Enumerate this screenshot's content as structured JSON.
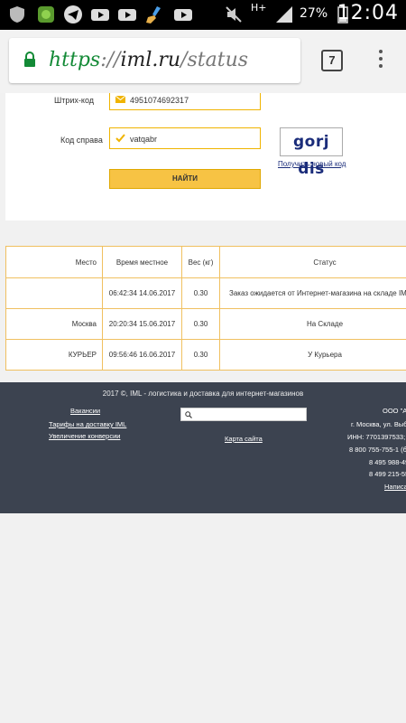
{
  "statusbar": {
    "network": "H+",
    "battery": "27%",
    "time": "12:04",
    "icons": [
      "shield-icon",
      "app-icon",
      "telegram-icon",
      "youtube-icon",
      "youtube-icon",
      "broom-icon",
      "youtube-icon",
      "mute-icon",
      "signal-icon",
      "battery-icon"
    ]
  },
  "browser": {
    "url_scheme": "https",
    "url_separator": "://",
    "url_host": "iml.ru",
    "url_path": "/status",
    "tab_count": "7"
  },
  "form": {
    "barcode_label": "Штрих-код",
    "barcode_value": "4951074692317",
    "captcha_label": "Код справа",
    "captcha_value": "vatqabr",
    "captcha_image_text": "gorj dis",
    "new_code_link": "Получить новый код",
    "submit_label": "НАЙТИ"
  },
  "table": {
    "headers": [
      "Место",
      "Время местное",
      "Вес (кг)",
      "Статус"
    ],
    "rows": [
      {
        "place": "",
        "time": "06:42:34 14.06.2017",
        "weight": "0.30",
        "status": "Заказ ожидается от Интернет-магазина на складе IML"
      },
      {
        "place": "Москва",
        "time": "20:20:34 15.06.2017",
        "weight": "0.30",
        "status": "На Складе"
      },
      {
        "place": "КУРЬЕР",
        "time": "09:56:46 16.06.2017",
        "weight": "0.30",
        "status": "У Курьера"
      }
    ]
  },
  "footer": {
    "copyright": "2017 ©, IML - логистика и доставка для интернет-магазинов",
    "links": [
      "Вакансии",
      "Тарифы на доставку IML",
      "Увеличение конверсии"
    ],
    "sitemap": "Карта сайта",
    "search_placeholder": "",
    "company": "ООО \"АЙ",
    "address": "г. Москва, ул. Выбо",
    "inn": "ИНН: 7701397533; О",
    "phone1": "8 800 755-755-1 (бе",
    "phone2": "8 495 988-49",
    "phone3": "8 499 215-55",
    "write_link": "Написа"
  },
  "colors": {
    "accent": "#f7c344",
    "border": "#f0c060",
    "footer_bg": "#3c4350",
    "link": "#1a2c7a"
  }
}
